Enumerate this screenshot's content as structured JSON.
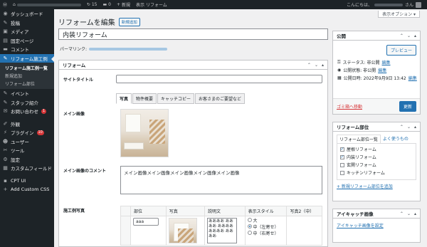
{
  "admin_bar": {
    "comments_count": "15",
    "updates_count": "0",
    "new_label": "新規",
    "view_label": "表示 リフォーム",
    "greeting": "こんにちは、",
    "greeting_suffix": "さん"
  },
  "sidebar": {
    "items": [
      {
        "icon": "dashboard-icon",
        "glyph": "◉",
        "label": "ダッシュボード"
      },
      {
        "icon": "pin-icon",
        "glyph": "✎",
        "label": "投稿"
      },
      {
        "icon": "media-icon",
        "glyph": "▣",
        "label": "メディア"
      },
      {
        "icon": "page-icon",
        "glyph": "▤",
        "label": "固定ページ"
      },
      {
        "icon": "comment-icon",
        "glyph": "▬",
        "label": "コメント"
      },
      {
        "icon": "pin-icon",
        "glyph": "✎",
        "label": "リフォーム施工例"
      }
    ],
    "submenu": [
      "リフォーム施工例一覧",
      "新規追加",
      "リフォーム部位"
    ],
    "items2": [
      {
        "icon": "pin-icon",
        "glyph": "✎",
        "label": "イベント"
      },
      {
        "icon": "pin-icon",
        "glyph": "✎",
        "label": "スタッフ紹介"
      },
      {
        "icon": "mail-icon",
        "glyph": "✉",
        "label": "お問い合わせ",
        "badge": "1"
      }
    ],
    "items3": [
      {
        "icon": "appearance-icon",
        "glyph": "✐",
        "label": "外観"
      },
      {
        "icon": "plugin-icon",
        "glyph": "⚡",
        "label": "プラグイン",
        "badge": "10"
      },
      {
        "icon": "users-icon",
        "glyph": "☻",
        "label": "ユーザー"
      },
      {
        "icon": "tools-icon",
        "glyph": "✂",
        "label": "ツール"
      },
      {
        "icon": "settings-icon",
        "glyph": "⚙",
        "label": "設定"
      },
      {
        "icon": "custom-field-icon",
        "glyph": "▦",
        "label": "カスタムフィールド"
      }
    ],
    "items4": [
      {
        "icon": "cpt-icon",
        "glyph": "▪",
        "label": "CPT UI"
      },
      {
        "icon": "css-icon",
        "glyph": "+",
        "label": "Add Custom CSS"
      }
    ]
  },
  "screen_options": "表示オプション ▾",
  "page": {
    "heading": "リフォームを編集",
    "add_new": "新規追加",
    "post_title": "内装リフォーム",
    "permalink_label": "パーマリンク:"
  },
  "reform_box": {
    "title": "リフォーム",
    "site_title_label": "サイトタイトル",
    "tabs": [
      "写真",
      "物件概要",
      "キャッチコピー",
      "お客さまのご要望など"
    ],
    "main_image_label": "メイン画像",
    "main_image_comment_label": "メイン画像のコメント",
    "main_image_comment": "メイン画像メイン画像メイン画像メイン画像メイン画像",
    "photos_label": "施工例写真",
    "table_headers": [
      "部位",
      "写真",
      "説明文",
      "表示スタイル",
      "写真2（中）"
    ],
    "row": {
      "part": "aaa",
      "desc": "ああああ ああああ ああああ ああああ ああああ",
      "styles": [
        "大",
        "中（左寄せ）",
        "中（右寄せ）"
      ]
    }
  },
  "publish_box": {
    "title": "公開",
    "preview": "プレビュー",
    "status": "ステータス: 非公開",
    "status_edit": "編集",
    "visibility": "公開状態: 非公開",
    "visibility_edit": "編集",
    "date": "公開日時: 2022年9月9日 13:42",
    "date_edit": "編集",
    "trash": "ゴミ箱へ移動",
    "update": "更新"
  },
  "taxonomy_box": {
    "title": "リフォーム部位",
    "tab_all": "リフォーム部位一覧",
    "tab_popular": "よく使うもの",
    "terms": [
      {
        "label": "屋根リフォーム",
        "checked": true
      },
      {
        "label": "内装リフォーム",
        "checked": true
      },
      {
        "label": "玄関リフォーム",
        "checked": false
      },
      {
        "label": "キッチンリフォーム",
        "checked": false
      }
    ],
    "add_new": "+ 新規リフォーム部位を追加"
  },
  "thumbnail_box": {
    "title": "アイキャッチ画像",
    "set_link": "アイキャッチ画像を設定"
  },
  "colors": {
    "admin_dark": "#1d2327",
    "accent": "#2271b1",
    "danger": "#d63638"
  }
}
